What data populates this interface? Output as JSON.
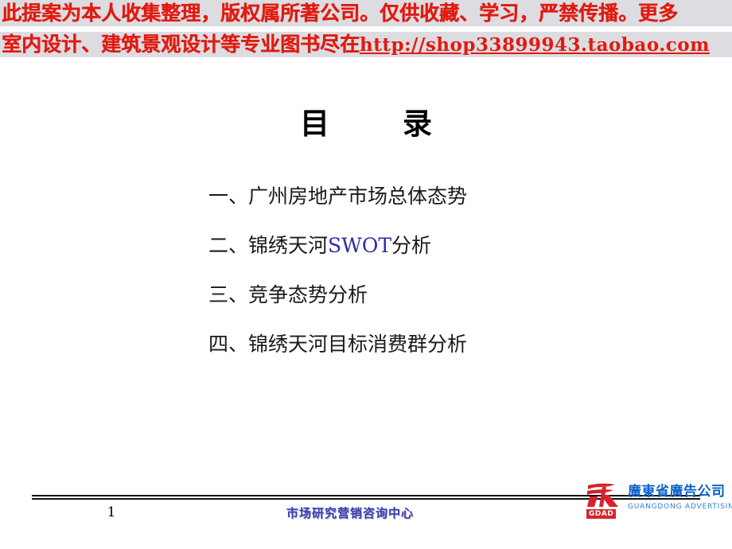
{
  "banner": {
    "line1": "此提案为本人收集整理，版权属所著公司。仅供收藏、学习，严禁传播。更多",
    "line2_prefix": "室内设计、建筑景观设计等专业图书尽在 ",
    "line2_url": "http://shop33899943.taobao.com",
    "color": "#e01b10",
    "background": "#dddce1"
  },
  "title": {
    "char1": "目",
    "char2": "录"
  },
  "toc": {
    "items": [
      {
        "num": "一、",
        "text": "广州房地产市场总体态势",
        "highlight": "",
        "tail": ""
      },
      {
        "num": "二、",
        "text": "锦绣天河",
        "highlight": "SWOT",
        "tail": "分析"
      },
      {
        "num": "三、",
        "text": "竞争态势分析",
        "highlight": "",
        "tail": ""
      },
      {
        "num": "四、",
        "text": "锦绣天河目标消费群分析",
        "highlight": "",
        "tail": ""
      }
    ],
    "highlight_color": "#2b2bab"
  },
  "footer": {
    "page_number": "1",
    "center_text": "市场研究营销咨询中心",
    "center_color": "#3b3bb0"
  },
  "logo": {
    "chinese_name": "廣東省廣告公司",
    "abbrev": "GDAD",
    "english_name": "GUANGDONG ADVERTISING CORP",
    "mark_color": "#d8232a",
    "text_color": "#0a62c8"
  }
}
